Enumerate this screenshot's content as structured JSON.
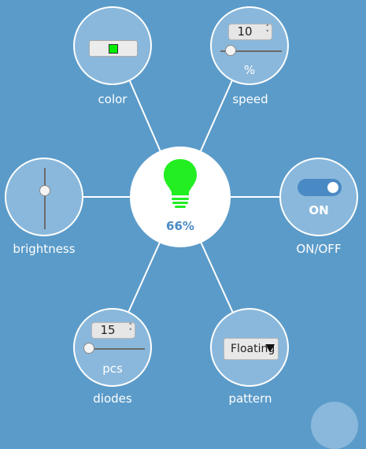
{
  "center": {
    "percent": "66%",
    "bulb_color": "#22ee22",
    "icon": "lightbulb-icon"
  },
  "nodes": {
    "color": {
      "label": "color",
      "swatch": "#00ee00"
    },
    "speed": {
      "label": "speed",
      "value": "10",
      "unit": "%",
      "slider_fraction": 0.1
    },
    "brightness": {
      "label": "brightness",
      "slider_fraction": 0.66
    },
    "onoff": {
      "label": "ON/OFF",
      "state": "ON"
    },
    "diodes": {
      "label": "diodes",
      "value": "15",
      "unit": "pcs",
      "slider_fraction": 0.0
    },
    "pattern": {
      "label": "pattern",
      "selected": "Floating"
    }
  },
  "colors": {
    "background": "#5b9bc9",
    "node_fill": "#8ab8dc",
    "accent": "#4a8ac4",
    "percent_text": "#4a8ac4"
  }
}
